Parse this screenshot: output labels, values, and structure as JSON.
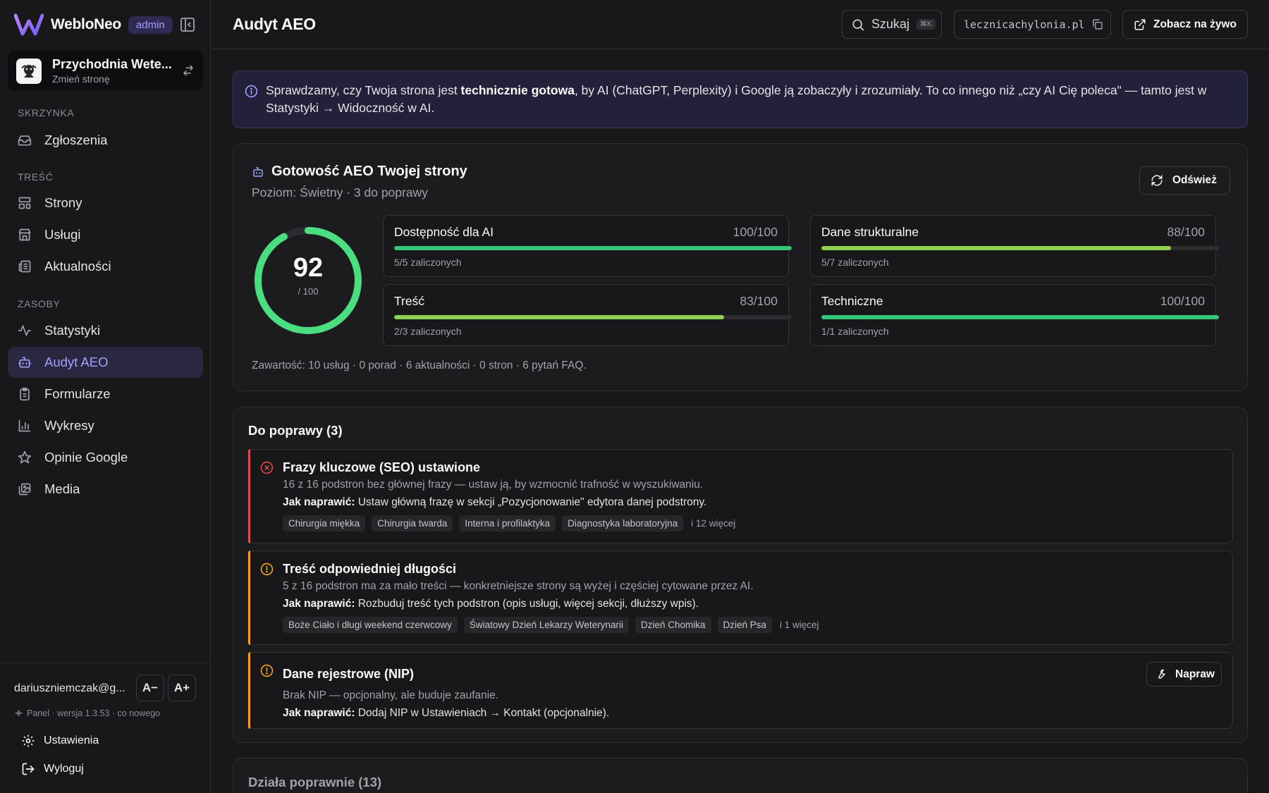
{
  "brand": {
    "name": "WebloNeo",
    "role": "admin"
  },
  "site": {
    "name": "Przychodnia Wete...",
    "switch_label": "Zmień stronę"
  },
  "nav": {
    "sections": {
      "inbox": "SKRZYNKA",
      "content": "TREŚĆ",
      "resources": "ZASOBY"
    },
    "items": [
      {
        "label": "Zgłoszenia",
        "icon": "inbox-icon"
      },
      {
        "label": "Strony",
        "icon": "layout-icon"
      },
      {
        "label": "Usługi",
        "icon": "store-icon"
      },
      {
        "label": "Aktualności",
        "icon": "newspaper-icon"
      },
      {
        "label": "Statystyki",
        "icon": "activity-icon"
      },
      {
        "label": "Audyt AEO",
        "icon": "bot-icon",
        "active": true
      },
      {
        "label": "Formularze",
        "icon": "clipboard-icon"
      },
      {
        "label": "Wykresy",
        "icon": "bar-chart-icon"
      },
      {
        "label": "Opinie Google",
        "icon": "star-icon"
      },
      {
        "label": "Media",
        "icon": "images-icon"
      }
    ]
  },
  "footer": {
    "email": "dariuszniemczak@g...",
    "font_decrease": "A−",
    "font_increase": "A+",
    "version": "Panel · wersja 1.3.53 · co nowego",
    "settings": "Ustawienia",
    "logout": "Wyloguj"
  },
  "topbar": {
    "title": "Audyt AEO",
    "search_label": "Szukaj",
    "search_shortcut": "⌘K",
    "domain": "lecznicachylonia.pl",
    "live_label": "Zobacz na żywo"
  },
  "banner": {
    "text_before": "Sprawdzamy, czy Twoja strona jest ",
    "text_bold": "technicznie gotowa",
    "text_after": ", by AI (ChatGPT, Perplexity) i Google ją zobaczyły i zrozumiały. To co innego niż „czy AI Cię poleca\" — tamto jest w Statystyki → Widoczność w AI."
  },
  "readiness": {
    "title": "Gotowość AEO Twojej strony",
    "subtitle": "Poziom: Świetny · 3 do poprawy",
    "refresh_label": "Odśwież",
    "score": 92,
    "score_of": "/ 100",
    "metrics": [
      {
        "name": "Dostępność dla AI",
        "score_text": "100/100",
        "score": 100,
        "passed": "5/5 zaliczonych"
      },
      {
        "name": "Dane strukturalne",
        "score_text": "88/100",
        "score": 88,
        "passed": "5/7 zaliczonych"
      },
      {
        "name": "Treść",
        "score_text": "83/100",
        "score": 83,
        "passed": "2/3 zaliczonych"
      },
      {
        "name": "Techniczne",
        "score_text": "100/100",
        "score": 100,
        "passed": "1/1 zaliczonych"
      }
    ],
    "content_summary": "Zawartość: 10 usług · 0 porad · 6 aktualności · 0 stron · 6 pytań FAQ."
  },
  "issues": {
    "heading": "Do poprawy (3)",
    "fix_prefix": "Jak naprawić:",
    "items": [
      {
        "severity": "error",
        "title": "Frazy kluczowe (SEO) ustawione",
        "description": "16 z 16 podstron bez głównej frazy — ustaw ją, by wzmocnić trafność w wyszukiwaniu.",
        "fix": " Ustaw główną frazę w sekcji „Pozycjonowanie\" edytora danej podstrony.",
        "tags": [
          "Chirurgia miękka",
          "Chirurgia twarda",
          "Interna i profilaktyka",
          "Diagnostyka laboratoryjna"
        ],
        "more": "i 12 więcej"
      },
      {
        "severity": "warning",
        "title": "Treść odpowiedniej długości",
        "description": "5 z 16 podstron ma za mało treści — konkretniejsze strony są wyżej i częściej cytowane przez AI.",
        "fix": " Rozbuduj treść tych podstron (opis usługi, więcej sekcji, dłuższy wpis).",
        "tags": [
          "Boże Ciało i długi weekend czerwcowy",
          "Światowy Dzień Lekarzy Weterynarii",
          "Dzień Chomika",
          "Dzień Psa"
        ],
        "more": "i 1 więcej"
      },
      {
        "severity": "warning",
        "title": "Dane rejestrowe (NIP)",
        "description": "Brak NIP — opcjonalny, ale buduje zaufanie.",
        "fix": " Dodaj NIP w Ustawieniach → Kontakt (opcjonalnie).",
        "action_label": "Napraw"
      }
    ]
  },
  "passing": {
    "heading": "Działa poprawnie (13)"
  },
  "colors": {
    "accent": "#a5a0ff",
    "score_green": "#4ade80",
    "bar_green": "#34c77b",
    "bar_lime": "#8fd14f",
    "error": "#e5484d",
    "warning": "#f5a524"
  }
}
